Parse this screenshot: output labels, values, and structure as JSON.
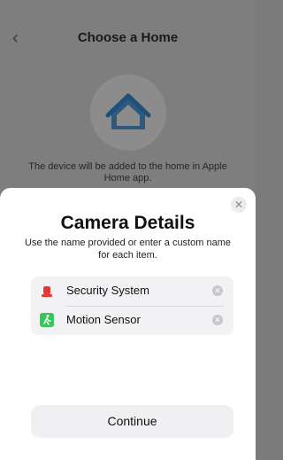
{
  "background": {
    "nav_title": "Choose a Home",
    "description": "The device will be added to the home in Apple Home app."
  },
  "sheet": {
    "title": "Camera Details",
    "subtitle": "Use the name provided or enter a custom name for each item.",
    "items": [
      {
        "label": "Security System",
        "icon": "siren-icon",
        "color": "#e53935"
      },
      {
        "label": "Motion Sensor",
        "icon": "motion-sensor-icon",
        "color": "#34c759"
      }
    ],
    "continue_label": "Continue"
  },
  "colors": {
    "overlay": "#7e7e7e",
    "sheet_bg": "#ffffff",
    "list_bg": "#f2f2f4",
    "accent_blue": "#0a84ff"
  }
}
